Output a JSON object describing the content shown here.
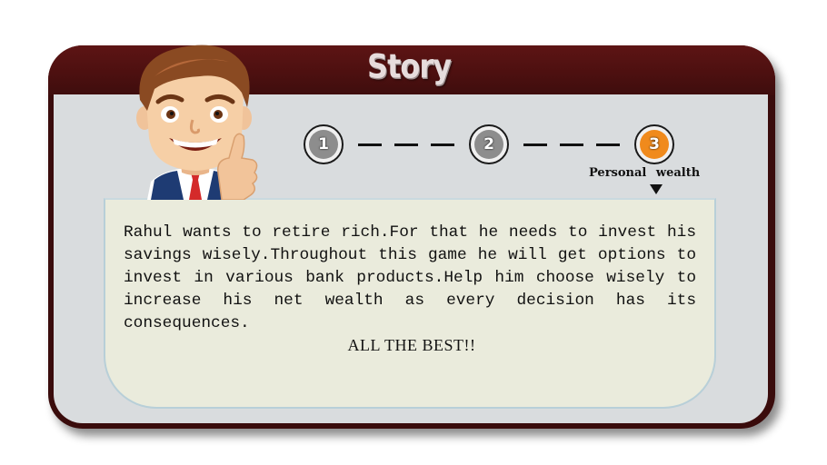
{
  "header": {
    "title": "Story"
  },
  "progress": {
    "steps": [
      {
        "label": "1",
        "state": "done"
      },
      {
        "label": "2",
        "state": "done"
      },
      {
        "label": "3",
        "state": "current"
      }
    ],
    "current_step": 3,
    "current_label": "Personal wealth"
  },
  "story": {
    "text": "Rahul wants to retire rich.For that he needs to invest his savings wisely.Throughout this game he will get options to invest in various bank products.Help him choose wisely to increase his net wealth as every decision has its consequences.",
    "closing": "ALL THE BEST!!"
  },
  "colors": {
    "frame": "#3a0c0c",
    "header": "#5d1414",
    "body": "#d9dcde",
    "panel": "#eaebdc",
    "step_inactive": "#8d8d8d",
    "step_active": "#f08a1c"
  },
  "icons": {
    "mascot": "businessman-thumbs-up-icon",
    "pointer": "triangle-down-icon"
  }
}
